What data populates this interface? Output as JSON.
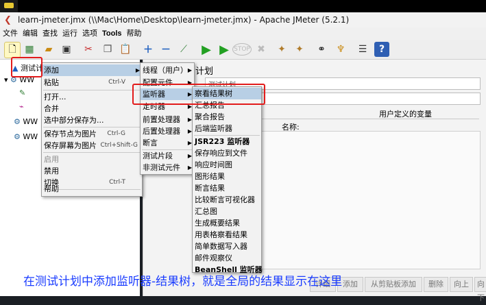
{
  "window": {
    "title": "learn-jmeter.jmx (\\\\Mac\\Home\\Desktop\\learn-jmeter.jmx) - Apache JMeter (5.2.1)"
  },
  "menubar": [
    "文件",
    "编辑",
    "查找",
    "运行",
    "选项",
    "Tools",
    "帮助"
  ],
  "tree": {
    "root": "测试计划",
    "items": [
      "WW",
      "WW",
      "WW"
    ]
  },
  "right": {
    "heading": "计划",
    "name_value": "测试计划",
    "user_vars_title": "用户定义的变量",
    "name_col": "名称:"
  },
  "menu1": {
    "items": [
      {
        "label": "添加",
        "arrow": true
      },
      {
        "label": "粘贴",
        "accel": "Ctrl-V"
      },
      {
        "label": "打开..."
      },
      {
        "label": "合并"
      },
      {
        "label": "选中部分保存为..."
      },
      {
        "label": "保存节点为图片",
        "accel": "Ctrl-G"
      },
      {
        "label": "保存屏幕为图片",
        "accel": "Ctrl+Shift-G"
      },
      {
        "label": "启用",
        "disabled": true
      },
      {
        "label": "禁用"
      },
      {
        "label": "切换",
        "accel": "Ctrl-T"
      },
      {
        "label": "帮助"
      }
    ]
  },
  "menu2": {
    "items": [
      {
        "label": "线程（用户）",
        "arrow": true
      },
      {
        "label": "配置元件",
        "arrow": true
      },
      {
        "label": "监听器",
        "arrow": true
      },
      {
        "label": "定时器",
        "arrow": true
      },
      {
        "label": "前置处理器",
        "arrow": true
      },
      {
        "label": "后置处理器",
        "arrow": true
      },
      {
        "label": "断言",
        "arrow": true
      },
      {
        "label": "测试片段",
        "arrow": true
      },
      {
        "label": "非测试元件",
        "arrow": true
      }
    ]
  },
  "menu3": {
    "items": [
      "察看结果树",
      "汇总报告",
      "聚合报告",
      "后端监听器",
      "JSR223 监听器",
      "保存响应到文件",
      "响应时间图",
      "图形结果",
      "断言结果",
      "比较断言可视化器",
      "汇总图",
      "生成概要结果",
      "用表格察看结果",
      "简单数据写入器",
      "邮件观察仪",
      "BeanShell 监听器"
    ]
  },
  "bottom_buttons": [
    "详细",
    "添加",
    "从剪贴板添加",
    "删除",
    "向上",
    "向下"
  ],
  "caption": "在测试计划中添加监听器-结果树，就是全局的结果显示在这里",
  "colors": {
    "highlight": "#b8cfe5",
    "redbox": "#e21b1b",
    "caption": "#1a3cff"
  }
}
